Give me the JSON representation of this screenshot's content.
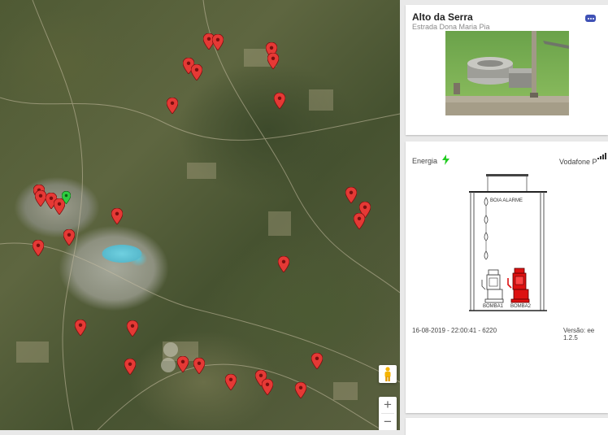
{
  "station": {
    "name": "Alto da Serra",
    "address": "Estrada Dona Maria Pia"
  },
  "status": {
    "energy_label": "Energia",
    "carrier": "Vodafone P",
    "float_alarm": "BOIA ALARME",
    "pump1": "BOMBA1",
    "pump2": "BOMBA2",
    "timestamp": "16-08-2019 - 22:00:41 - 6220",
    "version": "Versão:  ee 1.2.5",
    "pump1_state": "off",
    "pump2_state": "alarm"
  },
  "map_controls": {
    "zoom_in": "+",
    "zoom_out": "−"
  },
  "icons": {
    "chat": "chat-bubble-icon",
    "energy": "lightning-bolt-icon",
    "signal": "signal-bars-icon",
    "pegman": "street-view-pegman-icon",
    "marker": "map-marker-icon"
  },
  "colors": {
    "marker_red": "#e53935",
    "marker_green": "#2ecc40",
    "energy_green": "#22cc22",
    "chat_blue": "#3f51b5",
    "pump_alarm": "#dd1111"
  }
}
